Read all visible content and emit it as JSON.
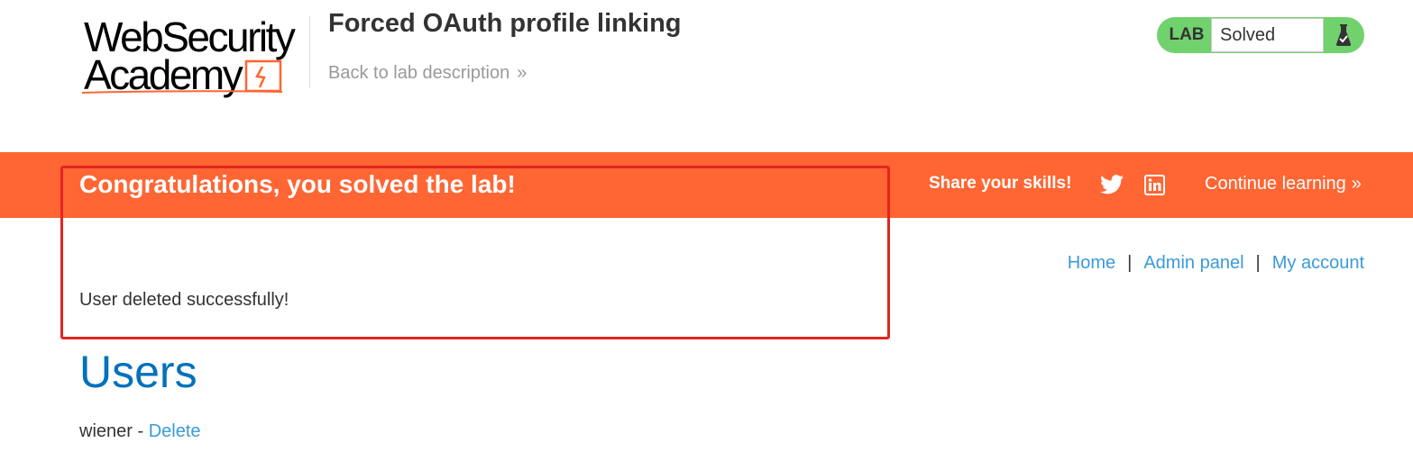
{
  "header": {
    "logo": {
      "line1": "WebSecurity",
      "line2": "Academy"
    },
    "lab_title": "Forced OAuth profile linking",
    "back_link": "Back to lab description",
    "back_chevron": "»",
    "lab_status": {
      "label": "LAB",
      "status": "Solved",
      "icon": "flask-check-icon",
      "color": "#70d16d"
    }
  },
  "banner": {
    "message": "Congratulations, you solved the lab!",
    "share_label": "Share your skills!",
    "twitter_icon": "twitter-icon",
    "linkedin_icon": "linkedin-icon",
    "continue_label": "Continue learning",
    "continue_chevron": "»",
    "color": "#ff6633"
  },
  "nav": {
    "items": [
      {
        "label": "Home"
      },
      {
        "label": "Admin panel"
      },
      {
        "label": "My account"
      }
    ],
    "separator": "|"
  },
  "main": {
    "success_message": "User deleted successfully!",
    "heading": "Users",
    "users": [
      {
        "username": "wiener",
        "separator": " - ",
        "action": "Delete"
      }
    ]
  },
  "annotation": {
    "highlight_color": "#e52421"
  }
}
